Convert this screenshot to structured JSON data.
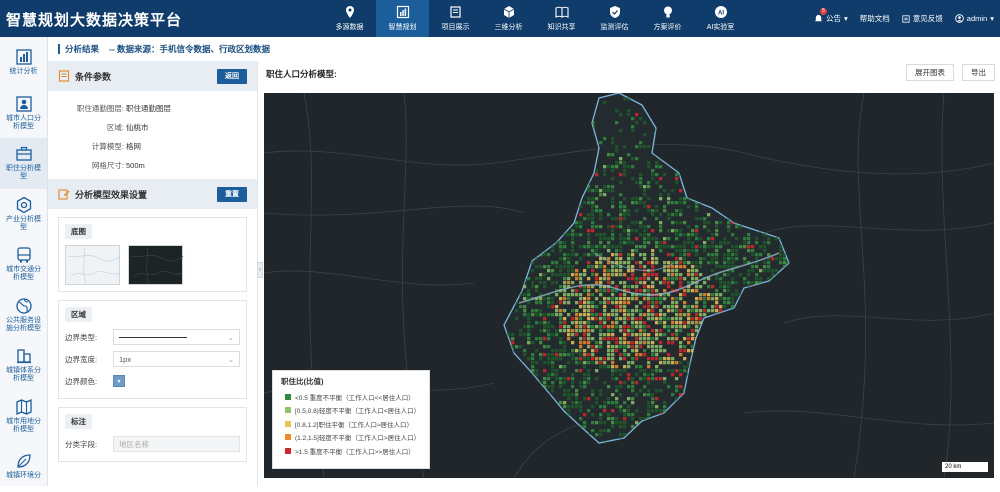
{
  "app": {
    "title": "智慧规划大数据决策平台"
  },
  "nav": [
    {
      "label": "多源数据",
      "icon": "map-pin-icon"
    },
    {
      "label": "智慧规划",
      "icon": "chart-icon",
      "active": true
    },
    {
      "label": "项目展示",
      "icon": "book-icon"
    },
    {
      "label": "三维分析",
      "icon": "cube-icon"
    },
    {
      "label": "知识共享",
      "icon": "open-book-icon"
    },
    {
      "label": "监测评估",
      "icon": "shield-icon"
    },
    {
      "label": "方案评价",
      "icon": "bulb-icon"
    },
    {
      "label": "AI实验室",
      "icon": "ai-icon"
    }
  ],
  "topright": {
    "notice": "公告",
    "notice_count": "5",
    "help": "帮助文档",
    "feedback": "意见反馈",
    "user": "admin"
  },
  "sidebar": [
    {
      "label": "统计分析"
    },
    {
      "label": "城市人口分析模型"
    },
    {
      "label": "职住分析模型",
      "active": true
    },
    {
      "label": "产业分析模型"
    },
    {
      "label": "城市交通分析模型"
    },
    {
      "label": "公共服务设施分析模型"
    },
    {
      "label": "城镇体系分析模型"
    },
    {
      "label": "城市用地分析模型"
    },
    {
      "label": "城镇环境分"
    }
  ],
  "subhead": {
    "title": "分析结果",
    "source": "-- 数据来源：手机信令数据、行政区划数据"
  },
  "conditions": {
    "title": "条件参数",
    "back": "返回",
    "rows": [
      {
        "k": "职住通勤图层:",
        "v": "职住通勤图层"
      },
      {
        "k": "区域:",
        "v": "仙桃市"
      },
      {
        "k": "计算模型:",
        "v": "格网"
      },
      {
        "k": "网格尺寸:",
        "v": "500m"
      }
    ]
  },
  "effect": {
    "title": "分析模型效果设置",
    "reset": "重置",
    "basemap_tab": "底图",
    "area_tab": "区域",
    "border_type_label": "边界类型:",
    "border_width_label": "边界宽度:",
    "border_width_value": "1px",
    "border_color_label": "边界颜色:",
    "note_tab": "标注",
    "field_label": "分类字段:",
    "field_placeholder": "地区名称"
  },
  "main": {
    "title": "职住人口分析模型:",
    "expand": "展开图表",
    "export": "导出"
  },
  "legend": {
    "title": "职住比(比值)",
    "items": [
      {
        "label": "<0.5 重度不平衡（工作人口<<居住人口）",
        "color": "#2e8b3e"
      },
      {
        "label": "[0.5,0.8)轻度不平衡（工作人口<居住人口）",
        "color": "#8cc26a"
      },
      {
        "label": "[0.8,1.2]职住平衡（工作人口≈居住人口）",
        "color": "#e8c35a"
      },
      {
        "label": "(1.2,1.5]轻度不平衡（工作人口>居住人口）",
        "color": "#ef8a2c"
      },
      {
        "label": ">1.5 重度不平衡（工作人口>>居住人口）",
        "color": "#d3262a"
      }
    ]
  },
  "scale": "20 km"
}
